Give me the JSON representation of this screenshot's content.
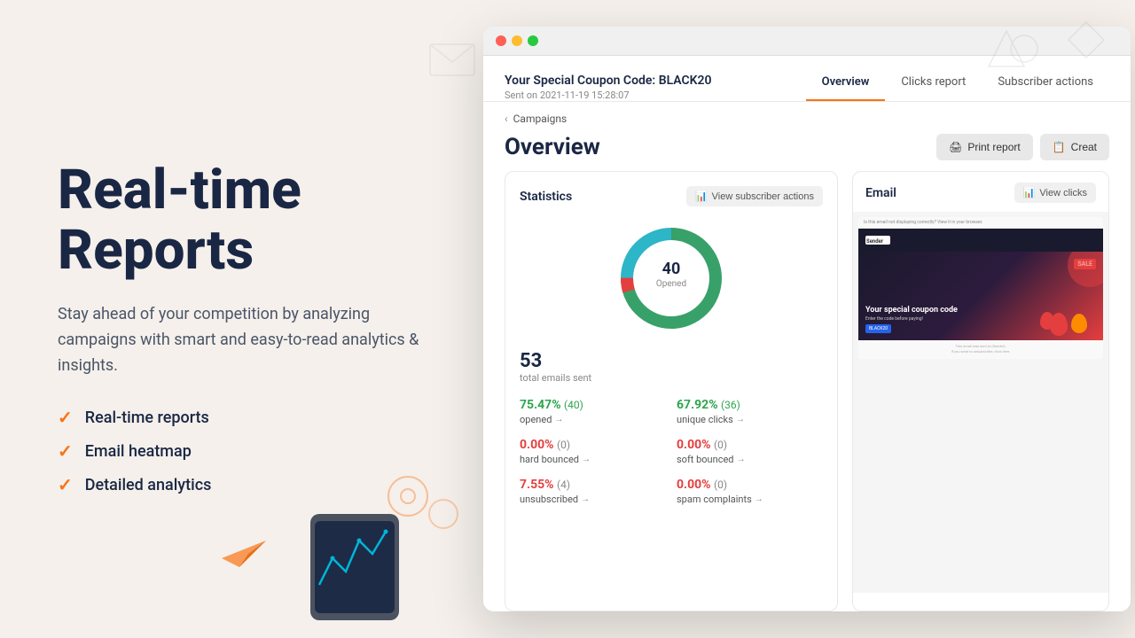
{
  "left": {
    "title_line1": "Real-time",
    "title_line2": "Reports",
    "subtitle": "Stay ahead of your competition by analyzing campaigns with smart and easy-to-read analytics & insights.",
    "features": [
      {
        "id": "f1",
        "label": "Real-time reports"
      },
      {
        "id": "f2",
        "label": "Email heatmap"
      },
      {
        "id": "f3",
        "label": "Detailed analytics"
      }
    ],
    "check_symbol": "✓"
  },
  "browser": {
    "campaign_title": "Your Special Coupon Code: BLACK20",
    "campaign_date": "Sent on 2021-11-19 15:28:07",
    "tabs": [
      {
        "id": "overview",
        "label": "Overview",
        "active": true
      },
      {
        "id": "clicks",
        "label": "Clicks report",
        "active": false
      },
      {
        "id": "subscriber",
        "label": "Subscriber actions",
        "active": false
      }
    ],
    "breadcrumb": "Campaigns",
    "page_title": "Overview",
    "buttons": {
      "print": "Print report",
      "create": "Creat"
    },
    "statistics_card": {
      "title": "Statistics",
      "view_btn": "View subscriber actions",
      "donut_number": "40",
      "donut_label": "Opened",
      "total_number": "53",
      "total_label": "total emails sent",
      "stats": [
        {
          "id": "opened",
          "percent": "75.47%",
          "count": "(40)",
          "label": "opened",
          "color": "green"
        },
        {
          "id": "unique_clicks",
          "percent": "67.92%",
          "count": "(36)",
          "label": "unique clicks",
          "color": "green"
        },
        {
          "id": "hard_bounced",
          "percent": "0.00%",
          "count": "(0)",
          "label": "hard bounced",
          "color": "red"
        },
        {
          "id": "soft_bounced",
          "percent": "0.00%",
          "count": "(0)",
          "label": "soft bounced",
          "color": "red"
        },
        {
          "id": "unsubscribed",
          "percent": "7.55%",
          "count": "(4)",
          "label": "unsubscribed",
          "color": "red"
        },
        {
          "id": "spam_complaints",
          "percent": "0.00%",
          "count": "(0)",
          "label": "spam complaints",
          "color": "red"
        }
      ]
    },
    "email_card": {
      "title": "Email",
      "view_btn": "View clicks",
      "preview_top_text": "Is this email not displaying correctly? View it in your browser.",
      "sale_text": "SALE",
      "coupon_title": "Your special coupon code",
      "coupon_sub": "Enter the code before paying!",
      "coupon_code": "BLACK20",
      "footer_text1": "This email was sent to (Sender).",
      "footer_text2": "If you want to unsubscribe, click here."
    }
  }
}
